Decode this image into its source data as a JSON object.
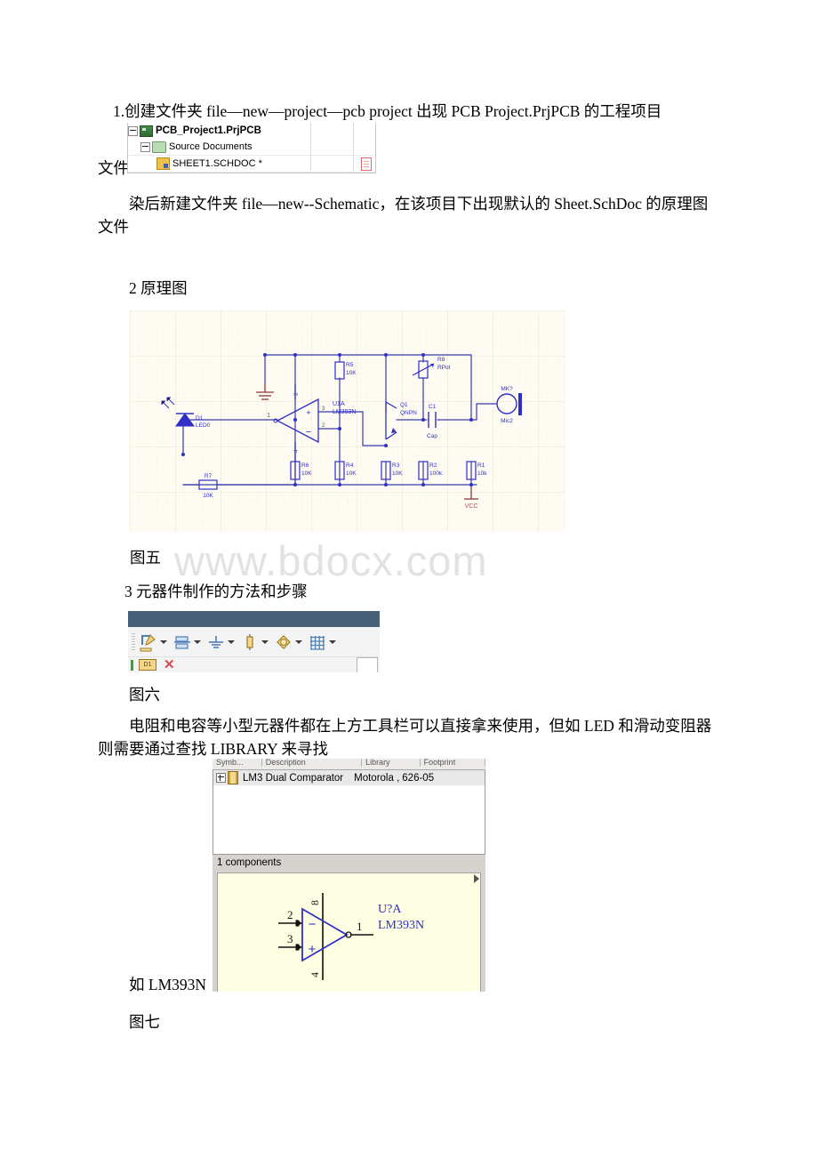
{
  "document": {
    "watermark": "www.bdocx.com",
    "paragraphs": [
      {
        "id": "p1",
        "text": "1.创建文件夹 file—new—project—pcb project 出现 PCB Project.PrjPCB 的工程项目"
      },
      {
        "id": "p2",
        "text": "文件"
      },
      {
        "id": "p3",
        "text": "染后新建文件夹 file—new--Schematic，在该项目下出现默认的 Sheet.SchDoc 的原理图文件"
      },
      {
        "id": "p4",
        "text": "2 原理图"
      },
      {
        "id": "p5",
        "text": "图五"
      },
      {
        "id": "p6",
        "text": "3 元器件制作的方法和步骤"
      },
      {
        "id": "p7",
        "text": "图六"
      },
      {
        "id": "p8",
        "text": "电阻和电容等小型元器件都在上方工具栏可以直接拿来使用，但如 LED 和滑动变阻器则需要通过查找 LIBRARY 来寻找"
      },
      {
        "id": "p9",
        "text": "如 LM393N"
      },
      {
        "id": "p10",
        "text": "图七"
      }
    ]
  },
  "project_tree": {
    "rows": [
      {
        "label": "PCB_Project1.PrjPCB",
        "icon": "project-icon"
      },
      {
        "label": "Source Documents",
        "icon": "folder-icon"
      },
      {
        "label": "SHEET1.SCHDOC *",
        "icon": "schematic-file-icon",
        "status_icon": "document-icon"
      }
    ]
  },
  "schematic": {
    "title": "图五",
    "net_labels": {
      "vcc": "VCC"
    },
    "components": [
      {
        "ref": "D1",
        "value": "LED0",
        "type": "led"
      },
      {
        "ref": "R7",
        "value": "10K",
        "type": "resistor"
      },
      {
        "ref": "R6",
        "value": "10K",
        "type": "resistor"
      },
      {
        "ref": "R5",
        "value": "10K",
        "type": "resistor"
      },
      {
        "ref": "R4",
        "value": "10K",
        "type": "resistor"
      },
      {
        "ref": "R3",
        "value": "10K",
        "type": "resistor"
      },
      {
        "ref": "R2",
        "value": "100k",
        "type": "resistor"
      },
      {
        "ref": "R1",
        "value": "10k",
        "type": "resistor"
      },
      {
        "ref": "R8",
        "value": "RPot",
        "type": "potentiometer"
      },
      {
        "ref": "U1A",
        "value": "LM393N",
        "type": "opamp",
        "pins": [
          "1",
          "2",
          "3",
          "8",
          "4"
        ]
      },
      {
        "ref": "Q1",
        "value": "QNPN",
        "type": "transistor"
      },
      {
        "ref": "C1",
        "value": "Cap",
        "type": "capacitor"
      },
      {
        "ref": "MK?",
        "value": "Mic2",
        "type": "microphone"
      }
    ]
  },
  "toolbar": {
    "title": "图六",
    "items": [
      {
        "icon": "draw-tool-icon",
        "has_dropdown": true
      },
      {
        "icon": "bus-icon",
        "has_dropdown": true
      },
      {
        "icon": "ground-icon",
        "has_dropdown": true
      },
      {
        "icon": "resistor-icon",
        "has_dropdown": true
      },
      {
        "icon": "signal-source-icon",
        "has_dropdown": true
      },
      {
        "icon": "grid-icon",
        "has_dropdown": true
      }
    ],
    "second_row": [
      {
        "icon": "designator-icon",
        "label": "D1"
      },
      {
        "icon": "delete-x-icon"
      }
    ]
  },
  "library_dialog": {
    "title": "图七",
    "columns": [
      "Symb...",
      "Description",
      "Library",
      "Footprint"
    ],
    "rows": [
      {
        "description": "LM3 Dual Comparator",
        "library": "Motorola ,",
        "footprint": "626-05"
      }
    ],
    "count_label": "1 components",
    "preview": {
      "designator": "U?A",
      "part": "LM393N",
      "pins": {
        "inverting": "2",
        "non_inverting": "3",
        "output": "1",
        "vcc": "8",
        "gnd": "4"
      },
      "symbols": {
        "minus": "−",
        "plus": "+"
      }
    }
  }
}
